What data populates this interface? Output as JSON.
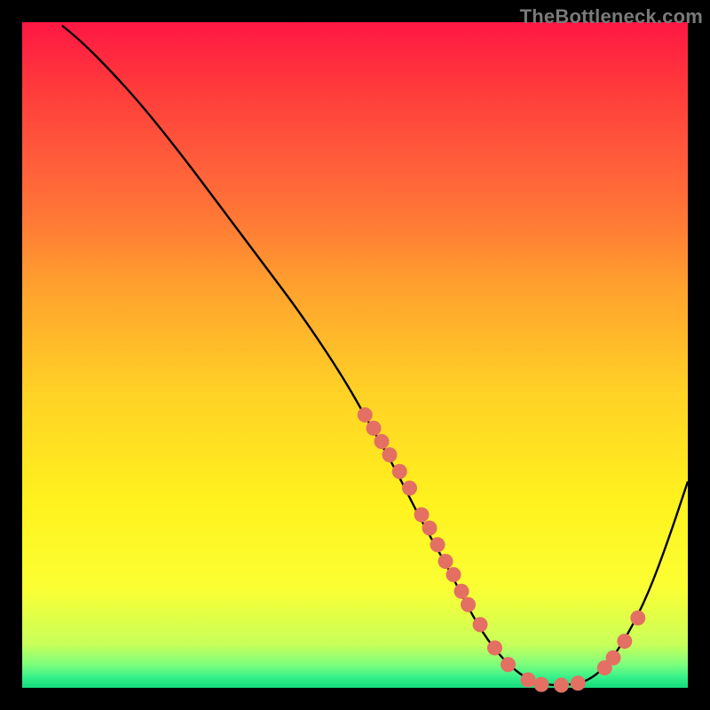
{
  "watermark": "TheBottleneck.com",
  "curve_stroke": "#000000",
  "curve_stroke_width": 2.4,
  "marker_fill": "#e37062",
  "marker_radius": 8.5,
  "chart_data": {
    "type": "line",
    "title": "",
    "xlabel": "",
    "ylabel": "",
    "xlim": [
      0,
      100
    ],
    "ylim": [
      0,
      100
    ],
    "x": [
      6,
      9,
      13,
      18,
      24,
      30,
      36,
      42,
      48,
      52,
      56,
      60,
      64,
      67,
      70,
      73,
      76,
      79,
      82,
      85,
      88,
      91,
      94,
      97,
      100
    ],
    "y": [
      99.5,
      97,
      93,
      87.5,
      80,
      72,
      64,
      56,
      47,
      40,
      33,
      25,
      18,
      12,
      7,
      3.5,
      1.2,
      0.4,
      0.4,
      1.0,
      3.5,
      8,
      14,
      22,
      31
    ],
    "series": [
      {
        "name": "markers",
        "x": [
          51.5,
          52.8,
          54.0,
          55.2,
          56.7,
          58.2,
          60.0,
          61.2,
          62.4,
          63.6,
          64.8,
          66.0,
          67.0,
          68.8,
          71.0,
          73.0,
          76.0,
          78.0,
          81.0,
          83.5,
          87.5,
          88.8,
          90.5,
          92.5
        ],
        "y": [
          41.0,
          39.0,
          37.0,
          35.0,
          32.5,
          30.0,
          26.0,
          24.0,
          21.5,
          19.0,
          17.0,
          14.5,
          12.5,
          9.5,
          6.0,
          3.5,
          1.2,
          0.5,
          0.4,
          0.7,
          3.0,
          4.5,
          7.0,
          10.5
        ]
      }
    ]
  }
}
